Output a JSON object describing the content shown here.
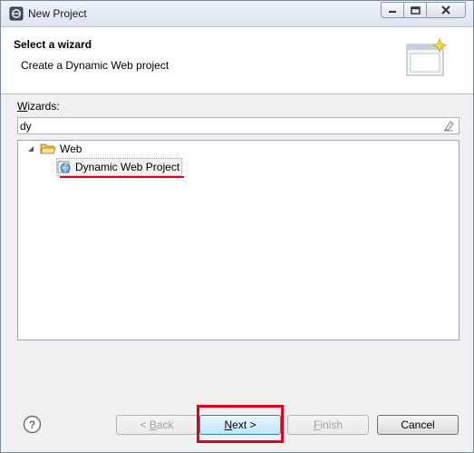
{
  "window": {
    "title": "New Project"
  },
  "header": {
    "title": "Select a wizard",
    "description": "Create a Dynamic Web project"
  },
  "wizards": {
    "label_underlined": "W",
    "label_rest": "izards:",
    "filter_value": "dy"
  },
  "tree": {
    "items": [
      {
        "label": "Web",
        "expanded": true,
        "icon": "folder-open-icon"
      },
      {
        "label": "Dynamic Web Project",
        "selected": true,
        "icon": "dynamic-web-project-icon"
      }
    ]
  },
  "buttons": {
    "back": {
      "mnemonic": "B",
      "prefix": "< ",
      "rest": "ack",
      "enabled": false
    },
    "next": {
      "mnemonic": "N",
      "rest": "ext >",
      "enabled": true
    },
    "finish": {
      "mnemonic": "F",
      "rest": "inish",
      "enabled": false
    },
    "cancel": {
      "label": "Cancel",
      "enabled": true
    }
  },
  "colors": {
    "annotation_red": "#e2001a",
    "default_button": "#bee6fd"
  }
}
